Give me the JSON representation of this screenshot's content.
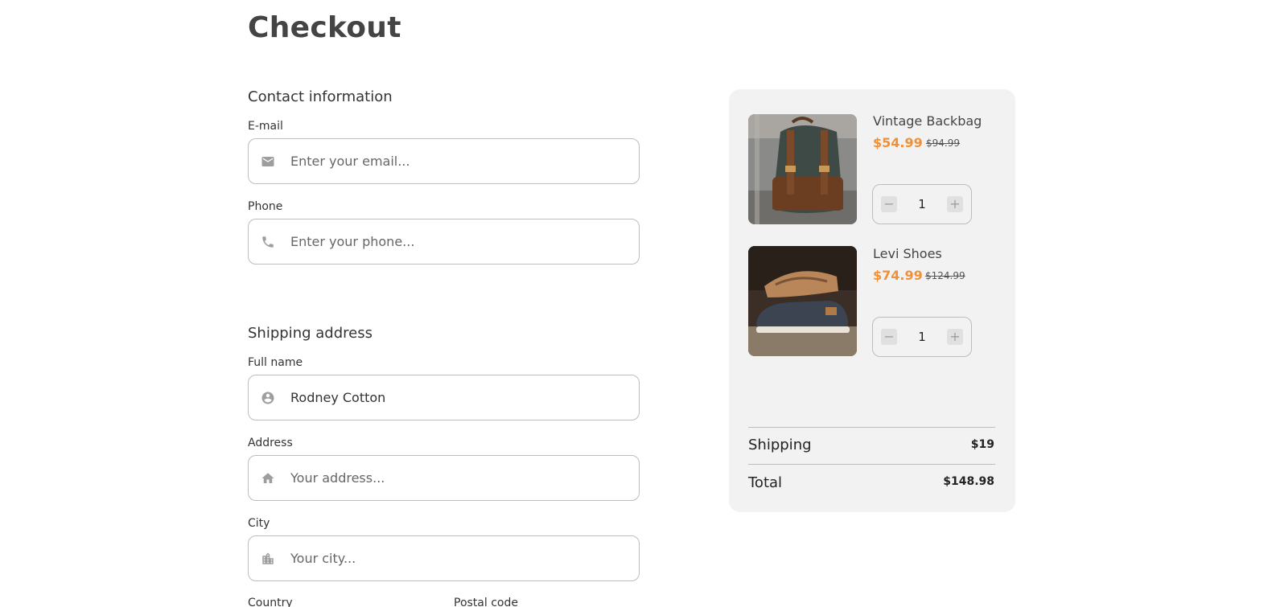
{
  "page": {
    "title": "Checkout"
  },
  "contact": {
    "title": "Contact information",
    "email": {
      "label": "E-mail",
      "placeholder": "Enter your email...",
      "value": ""
    },
    "phone": {
      "label": "Phone",
      "placeholder": "Enter your phone...",
      "value": ""
    }
  },
  "shipping": {
    "title": "Shipping address",
    "full_name": {
      "label": "Full name",
      "placeholder": "",
      "value": "Rodney Cotton"
    },
    "address": {
      "label": "Address",
      "placeholder": "Your address...",
      "value": ""
    },
    "city": {
      "label": "City",
      "placeholder": "Your city...",
      "value": ""
    },
    "country": {
      "label": "Country"
    },
    "postal_code": {
      "label": "Postal code"
    }
  },
  "summary": {
    "items": [
      {
        "name": "Vintage Backbag",
        "price": "$54.99",
        "original_price": "$94.99",
        "quantity": "1",
        "image_icon": "backpack-image"
      },
      {
        "name": "Levi Shoes",
        "price": "$74.99",
        "original_price": "$124.99",
        "quantity": "1",
        "image_icon": "shoes-image"
      }
    ],
    "shipping_label": "Shipping",
    "shipping_value": "$19",
    "total_label": "Total",
    "total_value": "$148.98"
  },
  "colors": {
    "accent": "#f0913a",
    "panel": "#f2f2f2",
    "border": "#bdbdbd"
  }
}
